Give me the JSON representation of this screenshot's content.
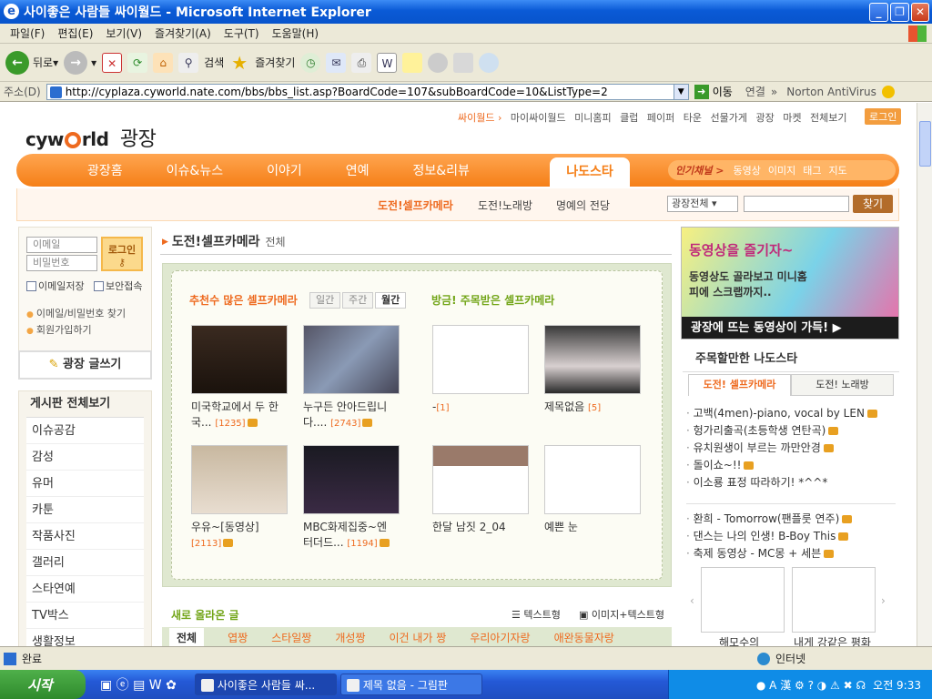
{
  "window": {
    "title": "사이좋은 사람들 싸이월드 - Microsoft Internet Explorer",
    "menu": [
      "파일(F)",
      "편집(E)",
      "보기(V)",
      "즐겨찾기(A)",
      "도구(T)",
      "도움말(H)"
    ]
  },
  "toolbar": {
    "back": "뒤로",
    "search": "검색",
    "favorites": "즐겨찾기"
  },
  "address": {
    "label": "주소(D)",
    "url": "http://cyplaza.cyworld.nate.com/bbs/bbs_list.asp?BoardCode=107&subBoardCode=10&ListType=2",
    "go": "이동",
    "links": "연결",
    "norton": "Norton AntiVirus"
  },
  "page": {
    "topnav": [
      "싸이월드 ›",
      "마이싸이월드",
      "미니홈피",
      "클럽",
      "페이퍼",
      "타운",
      "선물가게",
      "광장",
      "마켓",
      "전체보기"
    ],
    "login_top": "로그인",
    "logo_text": "cyworld",
    "logo_kor": "광장",
    "mainnav": [
      "광장홈",
      "이슈&뉴스",
      "이야기",
      "연예",
      "정보&리뷰"
    ],
    "mainnav_active": "나도스타",
    "popular": {
      "label": "인기채널 >",
      "items": [
        "동영상",
        "이미지",
        "태그",
        "지도"
      ]
    },
    "subnav": [
      "도전!셀프카메라",
      "도전!노래방",
      "명예의 전당"
    ],
    "search": {
      "scope": "광장전체",
      "button": "찾기"
    },
    "login": {
      "email_placeholder": "이메일",
      "password_placeholder": "비밀번호",
      "button": "로그인",
      "save_email": "이메일저장",
      "secure": "보안접속",
      "find": "이메일/비밀번호 찾기",
      "join": "회원가입하기"
    },
    "write_button": "광장 글쓰기",
    "board": {
      "title": "게시판 전체보기",
      "items": [
        "이슈공감",
        "감성",
        "유머",
        "카툰",
        "작품사진",
        "갤러리",
        "스타연예",
        "TV박스",
        "생활정보"
      ]
    },
    "content": {
      "title": "도전!셀프카메라",
      "subtitle": "전체",
      "recommended": "추천수 많은 셀프카메라",
      "period_tabs": [
        "일간",
        "주간",
        "월간"
      ],
      "noticed": "방금! 주목받은 셀프카메라",
      "grid": [
        {
          "line1": "미국학교에서 두 한",
          "line2": "국...",
          "count": "[1235]"
        },
        {
          "line1": "누구든 안아드립니",
          "line2": "다....",
          "count": "[2743]"
        },
        {
          "line1": "-",
          "line2": "",
          "count": "[1]"
        },
        {
          "line1": "제목없음",
          "line2": "",
          "count": "[5]"
        },
        {
          "line1": "우유~[동영상]",
          "line2": "",
          "count": "[2113]"
        },
        {
          "line1": "MBC화제집중~엔",
          "line2": "터더드...",
          "count": "[1194]"
        },
        {
          "line1": "한달 남짓 2_04",
          "line2": "",
          "count": ""
        },
        {
          "line1": "예쁜 눈",
          "line2": "",
          "count": ""
        }
      ],
      "new_posts": "새로 올라온 글",
      "view_text": "텍스트형",
      "view_image": "이미지+텍스트형",
      "post_tabs": [
        "전체",
        "엽짱",
        "스타일짱",
        "개성짱",
        "이건 내가 짱",
        "우리아기자랑",
        "애완동물자랑"
      ]
    },
    "banner": {
      "line1": "동영상을 즐기자~",
      "line2": "동영상도 골라보고 미니홈피에 스크랩까지..",
      "line3": "광장에 뜨는 동영상이 가득!"
    },
    "nado": {
      "title": "주목할만한 나도스타",
      "tabs": [
        "도전! 셀프카메라",
        "도전! 노래방"
      ],
      "list1": [
        "고백(4men)-piano, vocal by LEN",
        "헝가리출곡(초등학생 연탄곡)",
        "유치원생이 부르는 까만안경",
        "돌이쇼~!!",
        "이소룡 표정 따라하기! *^^*"
      ],
      "list2": [
        "환희 - Tomorrow(팬플룻 연주)",
        "댄스는 나의 인생! B-Boy This",
        "축제 동영상 - MC몽 + 세븐"
      ],
      "thumb_caps": [
        "해모수의",
        "내게 강같은 평화"
      ]
    }
  },
  "status": {
    "text": "완료",
    "zone": "인터넷"
  },
  "taskbar": {
    "start": "시작",
    "tasks": [
      "사이좋은 사람들 싸...",
      "제목 없음 - 그림판"
    ],
    "clock": "오전 9:33"
  }
}
